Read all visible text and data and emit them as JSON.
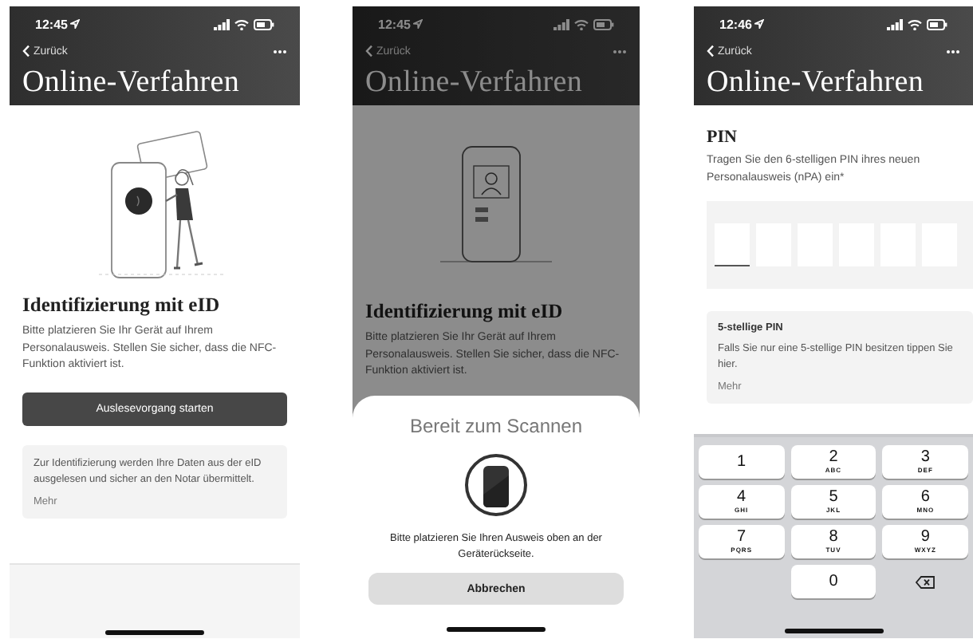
{
  "screens": [
    {
      "kind": "intro",
      "time": "12:45",
      "back": "Zurück",
      "title": "Online-Verfahren",
      "heading": "Identifizierung mit eID",
      "text": "Bitte platzieren Sie Ihr Gerät auf Ihrem Personalausweis. Stellen Sie sicher, dass die NFC-Funktion aktiviert ist.",
      "button": "Auslesevorgang starten",
      "info": {
        "text": "Zur Identifizierung werden Ihre Daten aus der eID ausgelesen und sicher an den Notar übermittelt.",
        "more": "Mehr"
      }
    },
    {
      "kind": "scan",
      "time": "12:45",
      "back": "Zurück",
      "title": "Online-Verfahren",
      "heading": "Identifizierung mit eID",
      "text": "Bitte platzieren Sie Ihr Gerät auf Ihrem Personalausweis. Stellen Sie sicher, dass die NFC-Funktion aktiviert ist.",
      "sheet": {
        "title": "Bereit zum Scannen",
        "text": "Bitte platzieren Sie Ihren Ausweis oben an der Geräterückseite.",
        "button": "Abbrechen"
      }
    },
    {
      "kind": "pin",
      "time": "12:46",
      "back": "Zurück",
      "title": "Online-Verfahren",
      "heading": "PIN",
      "text": "Tragen Sie den 6-stelligen PIN ihres neuen Personalausweis (nPA) ein*",
      "pin_fields": [
        {
          "focused": true
        },
        {
          "focused": false
        },
        {
          "focused": false
        },
        {
          "focused": false
        },
        {
          "focused": false
        },
        {
          "focused": false
        }
      ],
      "info": {
        "title": "5-stellige PIN",
        "text": "Falls Sie nur eine 5-stellige PIN besitzen tippen Sie hier.",
        "more": "Mehr"
      },
      "keys": [
        {
          "kind": "digit",
          "digit": "1"
        },
        {
          "kind": "digit",
          "digit": "2",
          "letters": "ABC"
        },
        {
          "kind": "digit",
          "digit": "3",
          "letters": "DEF"
        },
        {
          "kind": "digit",
          "digit": "4",
          "letters": "GHI"
        },
        {
          "kind": "digit",
          "digit": "5",
          "letters": "JKL"
        },
        {
          "kind": "digit",
          "digit": "6",
          "letters": "MNO"
        },
        {
          "kind": "digit",
          "digit": "7",
          "letters": "PQRS"
        },
        {
          "kind": "digit",
          "digit": "8",
          "letters": "TUV"
        },
        {
          "kind": "digit",
          "digit": "9",
          "letters": "WXYZ"
        },
        {
          "kind": "blank"
        },
        {
          "kind": "digit",
          "digit": "0"
        },
        {
          "kind": "delete"
        }
      ]
    }
  ]
}
